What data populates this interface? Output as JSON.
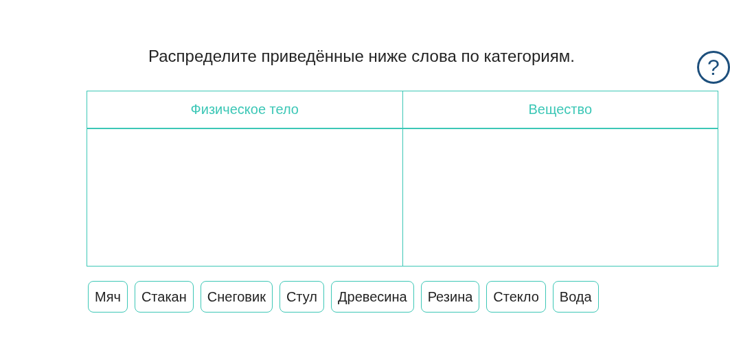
{
  "instruction": "Распределите приведённые ниже слова по категориям.",
  "help_button": "?",
  "categories": [
    {
      "title": "Физическое тело"
    },
    {
      "title": "Вещество"
    }
  ],
  "words": [
    "Мяч",
    "Стакан",
    "Снеговик",
    "Стул",
    "Древесина",
    "Резина",
    "Стекло",
    "Вода"
  ]
}
